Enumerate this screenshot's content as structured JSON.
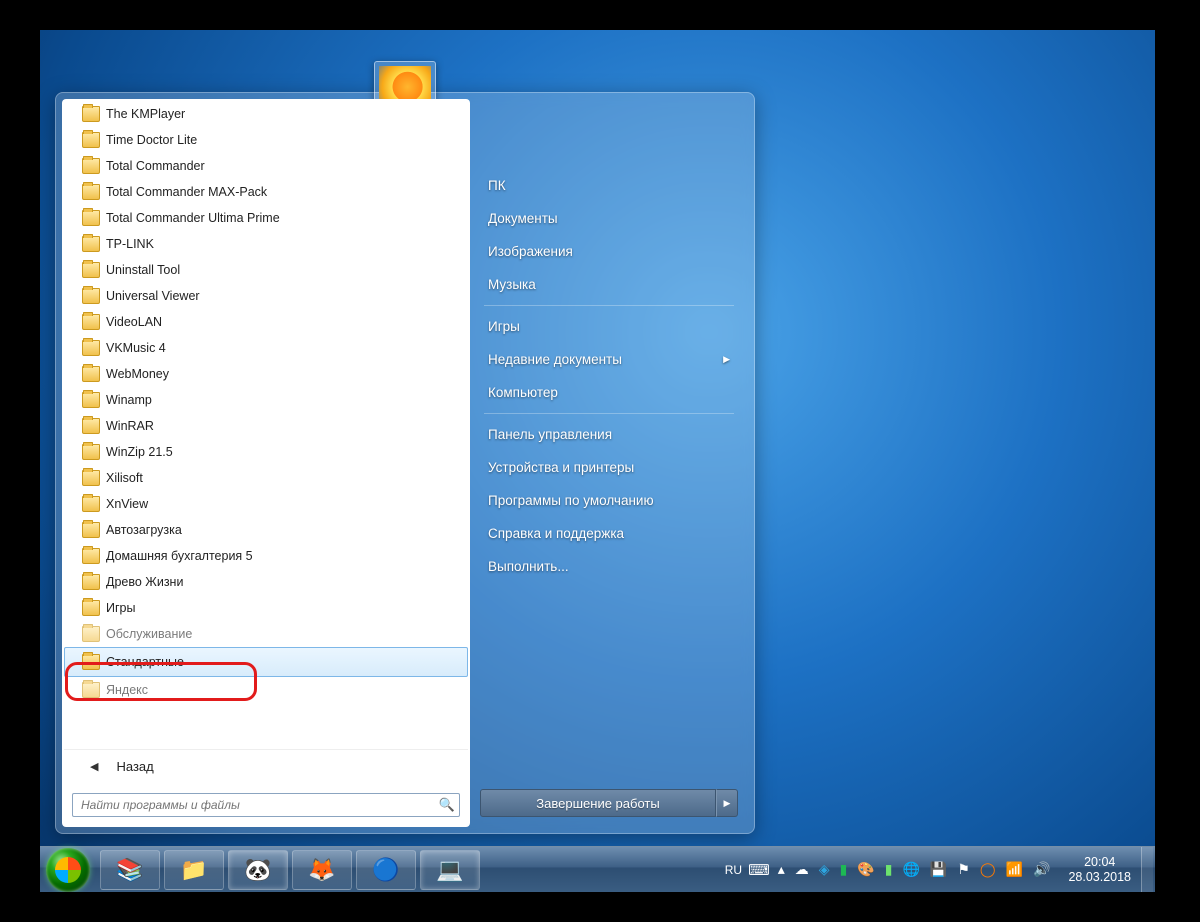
{
  "programs": [
    "The KMPlayer",
    "Time Doctor Lite",
    "Total Commander",
    "Total Commander MAX-Pack",
    "Total Commander Ultima Prime",
    "TP-LINK",
    "Uninstall Tool",
    "Universal Viewer",
    "VideoLAN",
    "VKMusic 4",
    "WebMoney",
    "Winamp",
    "WinRAR",
    "WinZip 21.5",
    "Xilisoft",
    "XnView",
    "Автозагрузка",
    "Домашняя бухгалтерия 5",
    "Древо Жизни",
    "Игры"
  ],
  "cutoff_item": "Обслуживание",
  "selected_item": "Стандартные",
  "after_selected": "Яндекс",
  "back_label": "Назад",
  "search_placeholder": "Найти программы и файлы",
  "right_menu": {
    "group1": [
      "ПК",
      "Документы",
      "Изображения",
      "Музыка"
    ],
    "group2": [
      "Игры",
      "Недавние документы",
      "Компьютер"
    ],
    "group3": [
      "Панель управления",
      "Устройства и принтеры",
      "Программы по умолчанию",
      "Справка и поддержка",
      "Выполнить..."
    ],
    "has_submenu": "Недавние документы"
  },
  "shutdown_label": "Завершение работы",
  "taskbar": {
    "lang": "RU",
    "time": "20:04",
    "date": "28.03.2018",
    "tray_icons": [
      "keyboard",
      "chevron-up",
      "cloud",
      "telegram",
      "app-green",
      "app-pixel",
      "signal",
      "globe",
      "drive",
      "flag",
      "app-orange",
      "wifi",
      "volume"
    ]
  }
}
